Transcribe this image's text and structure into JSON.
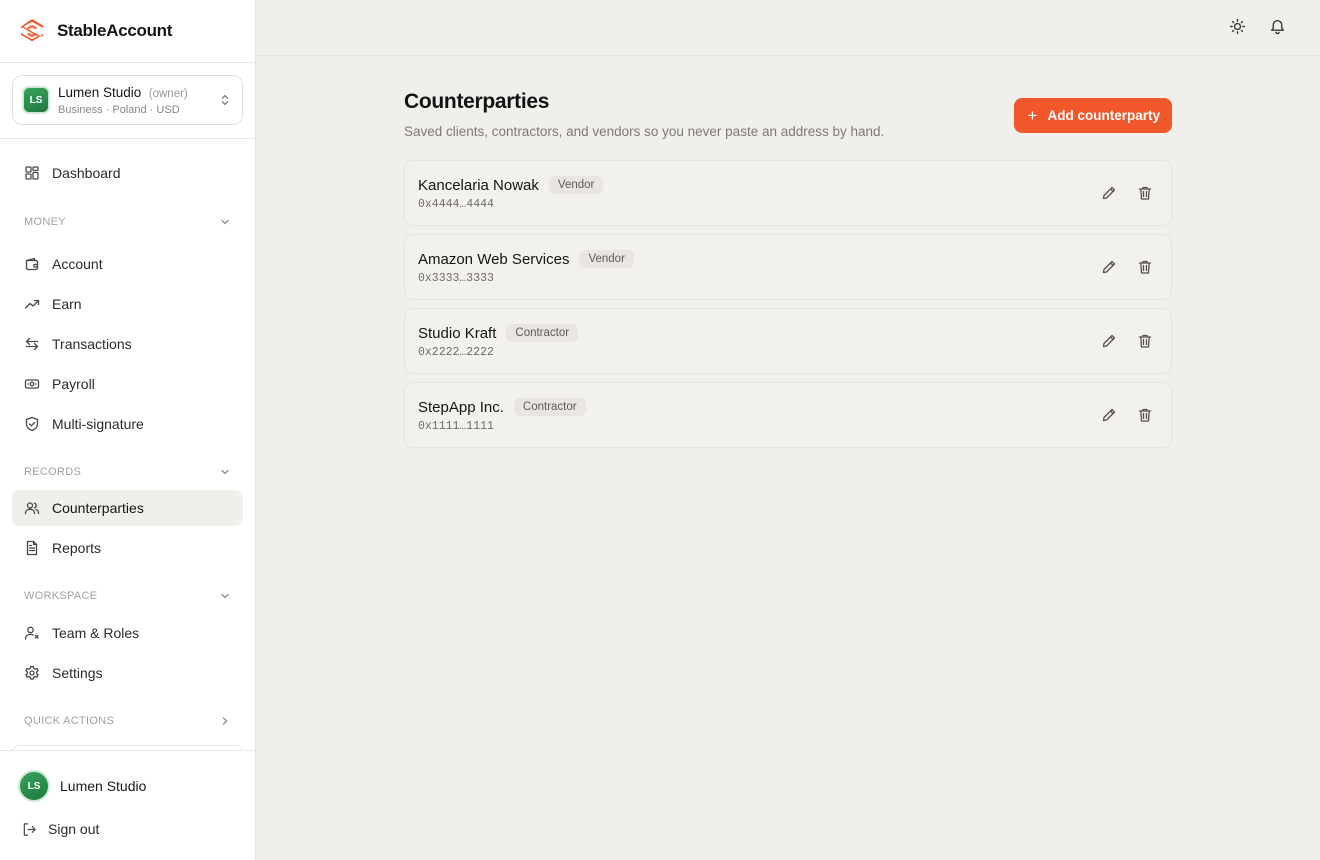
{
  "brand": {
    "name": "StableAccount",
    "accent": "#f2572c"
  },
  "org": {
    "initials": "LS",
    "name": "Lumen Studio",
    "role": "(owner)",
    "meta": "Business · Poland · USD"
  },
  "nav": {
    "dashboard": "Dashboard",
    "money": {
      "heading": "MONEY",
      "items": [
        "Account",
        "Earn",
        "Transactions",
        "Payroll",
        "Multi-signature"
      ]
    },
    "records": {
      "heading": "RECORDS",
      "items": [
        "Counterparties",
        "Reports"
      ]
    },
    "workspace": {
      "heading": "WORKSPACE",
      "items": [
        "Team & Roles",
        "Settings"
      ]
    },
    "quick_actions": {
      "heading": "QUICK ACTIONS"
    }
  },
  "footer": {
    "initials": "LS",
    "user_name": "Lumen Studio",
    "sign_out": "Sign out"
  },
  "page": {
    "title": "Counterparties",
    "subtitle": "Saved clients, contractors, and vendors so you never paste an address by hand.",
    "add_button": "Add counterparty"
  },
  "counterparties": [
    {
      "name": "Kancelaria Nowak",
      "type": "Vendor",
      "address": "0x4444…4444"
    },
    {
      "name": "Amazon Web Services",
      "type": "Vendor",
      "address": "0x3333…3333"
    },
    {
      "name": "Studio Kraft",
      "type": "Contractor",
      "address": "0x2222…2222"
    },
    {
      "name": "StepApp Inc.",
      "type": "Contractor",
      "address": "0x1111…1111"
    }
  ]
}
